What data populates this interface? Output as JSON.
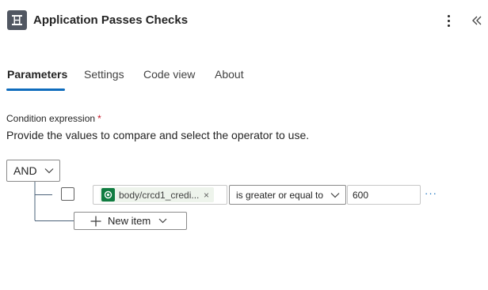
{
  "header": {
    "title": "Application Passes Checks",
    "app_icon": "condition-icon",
    "more_icon": "more-vertical-icon",
    "collapse_icon": "double-chevron-left-icon"
  },
  "tabs": [
    {
      "label": "Parameters",
      "active": true
    },
    {
      "label": "Settings",
      "active": false
    },
    {
      "label": "Code view",
      "active": false
    },
    {
      "label": "About",
      "active": false
    }
  ],
  "condition": {
    "label": "Condition expression",
    "required_marker": "*",
    "description": "Provide the values to compare and select the operator to use.",
    "group_operator": "AND",
    "rows": [
      {
        "checked": false,
        "left_token": "body/crcd1_credi...",
        "token_icon": "dataverse-icon",
        "token_remove": "×",
        "operator": "is greater or equal to",
        "right_value": "600",
        "more": "···"
      }
    ],
    "new_item_label": "New item"
  },
  "colors": {
    "accent": "#0f6cbd",
    "token_icon_bg": "#107c41",
    "token_bg": "#eef4ec",
    "required": "#c50f1f"
  }
}
